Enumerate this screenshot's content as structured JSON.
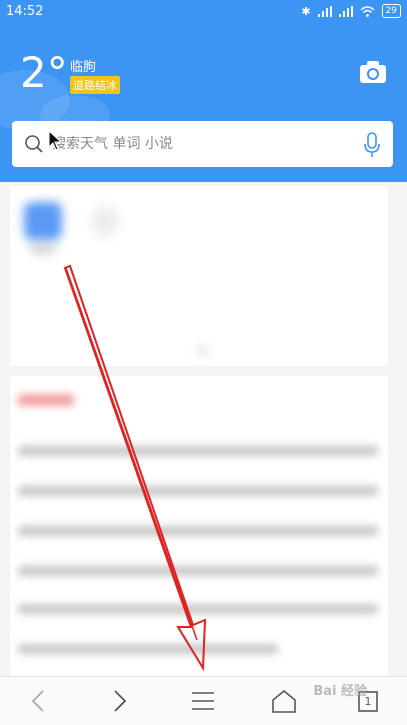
{
  "status_bar": {
    "time": "14:52",
    "battery": "29"
  },
  "weather": {
    "temperature": "2°",
    "city": "临朐",
    "alert": "道路结冰"
  },
  "search": {
    "placeholder": "搜索天气 单词 小说"
  },
  "colors": {
    "header": "#3d95f3",
    "alert_badge": "#f4c21a",
    "annotation_arrow": "#e12222",
    "mic": "#3d95f3"
  },
  "icons": [
    "camera-icon",
    "search-icon",
    "mic-icon",
    "back-icon",
    "forward-icon",
    "menu-icon",
    "home-icon",
    "tabs-icon"
  ],
  "nav": {
    "tabs_count": "1"
  },
  "watermark": "Bai 经验"
}
